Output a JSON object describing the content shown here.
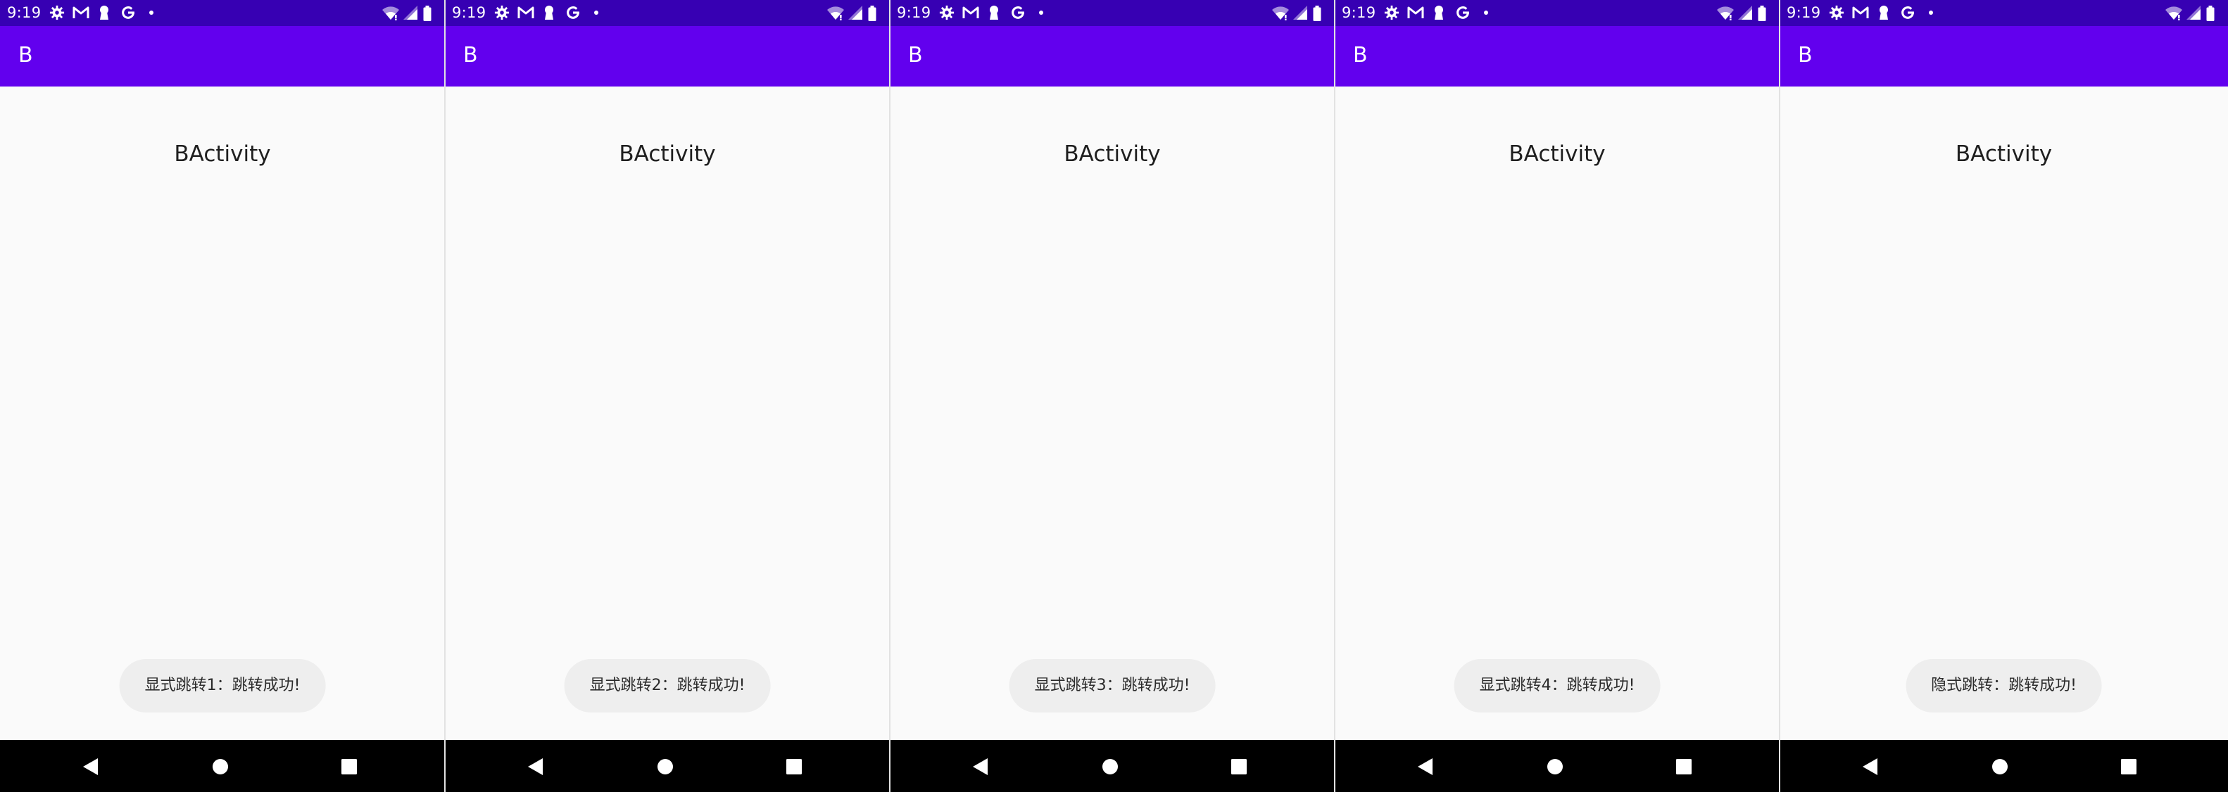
{
  "phones": [
    {
      "status_time": "9:19",
      "app_title": "B",
      "activity_label": "BActivity",
      "toast": "显式跳转1：跳转成功!"
    },
    {
      "status_time": "9:19",
      "app_title": "B",
      "activity_label": "BActivity",
      "toast": "显式跳转2：跳转成功!"
    },
    {
      "status_time": "9:19",
      "app_title": "B",
      "activity_label": "BActivity",
      "toast": "显式跳转3：跳转成功!"
    },
    {
      "status_time": "9:19",
      "app_title": "B",
      "activity_label": "BActivity",
      "toast": "显式跳转4：跳转成功!"
    },
    {
      "status_time": "9:19",
      "app_title": "B",
      "activity_label": "BActivity",
      "toast": "隐式跳转：跳转成功!"
    }
  ],
  "colors": {
    "status_bar": "#3700b3",
    "app_bar": "#6200ee",
    "content_background": "#fafafa",
    "toast_background": "#eeeeee",
    "navigation_bar": "#000000"
  },
  "status_icons": [
    "settings-icon",
    "gmail-icon",
    "keyhole-icon",
    "google-icon",
    "notification-dot-icon",
    "wifi-icon",
    "signal-icon",
    "battery-icon"
  ],
  "navigation_icons": [
    "back-icon",
    "home-icon",
    "recents-icon"
  ]
}
